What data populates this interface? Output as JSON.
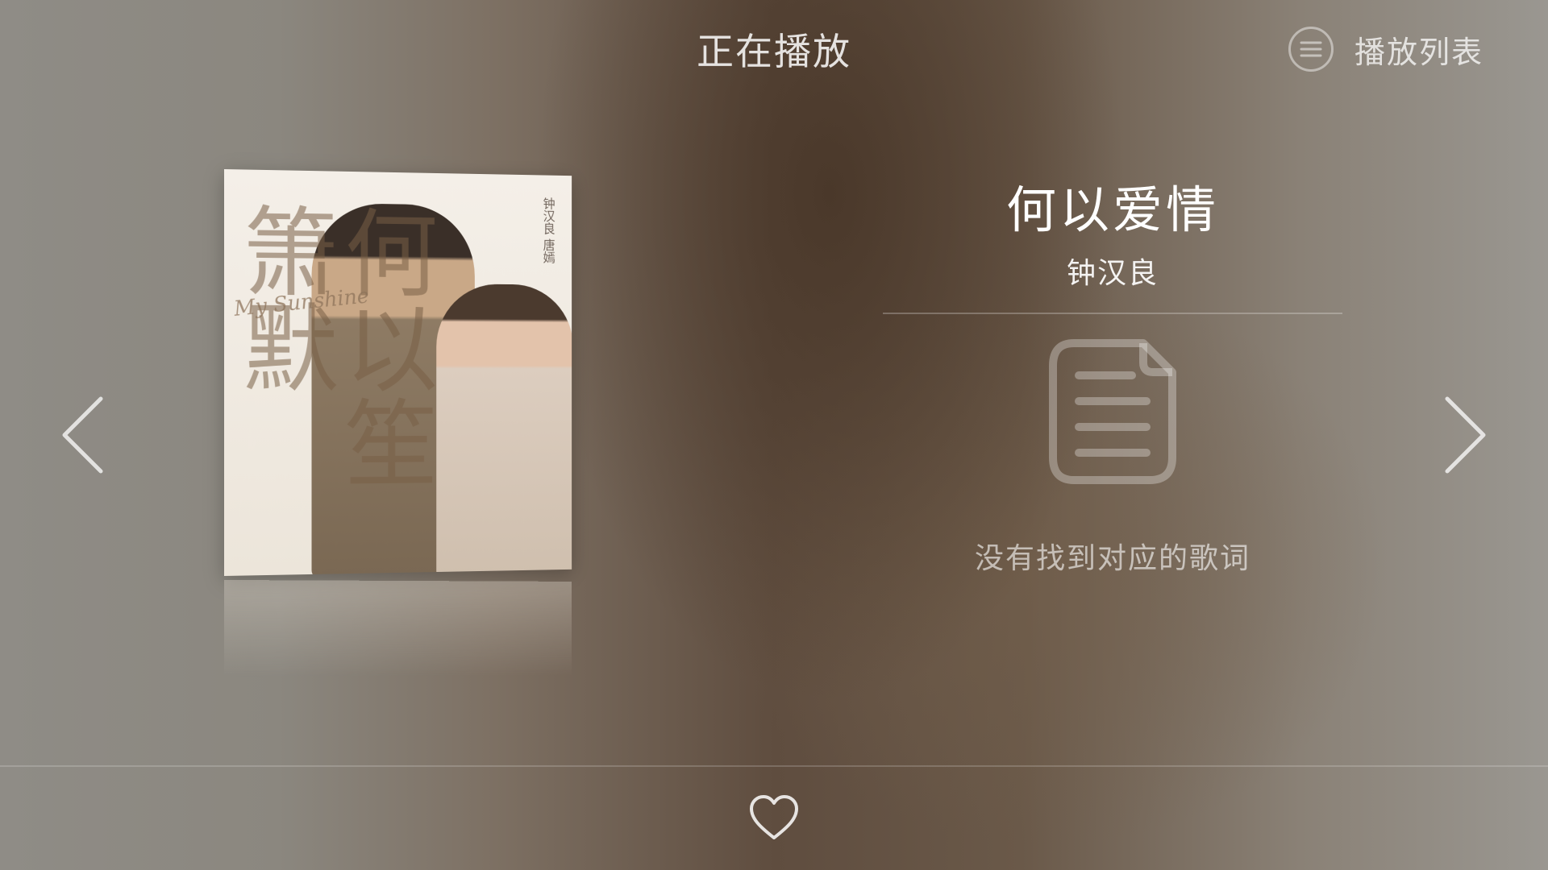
{
  "header": {
    "title": "正在播放",
    "playlist_label": "播放列表",
    "playlist_icon": "list-circle-icon"
  },
  "album": {
    "cover_title_art": "何以笙箫默",
    "cover_script": "My Sunshine",
    "cover_credits": "钟汉良 唐嫣"
  },
  "track": {
    "title": "何以爱情",
    "artist": "钟汉良"
  },
  "lyrics": {
    "icon": "document-icon",
    "empty_message": "没有找到对应的歌词"
  },
  "navigation": {
    "prev_icon": "chevron-left-icon",
    "next_icon": "chevron-right-icon"
  },
  "footer": {
    "favorite_icon": "heart-icon"
  },
  "colors": {
    "background_dark": "#5f4d3f",
    "background_light": "#8f8c86",
    "text_primary": "#ffffff"
  }
}
